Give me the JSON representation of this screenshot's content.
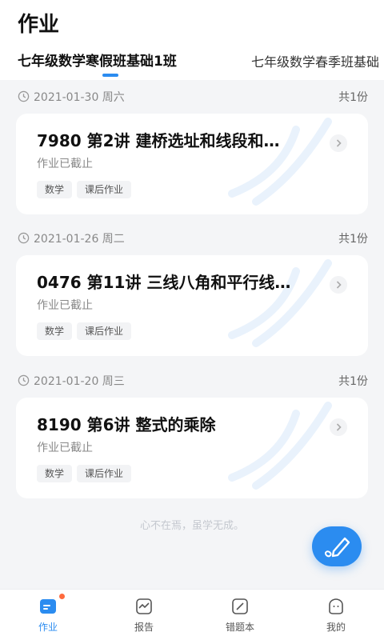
{
  "header": {
    "title": "作业"
  },
  "tabs": [
    {
      "label": "七年级数学寒假班基础1班",
      "active": true
    },
    {
      "label": "七年级数学春季班基础",
      "active": false
    }
  ],
  "groups": [
    {
      "date": "2021-01-30 周六",
      "count": "共1份",
      "card": {
        "title": "7980 第2讲 建桥选址和线段和…",
        "status": "作业已截止",
        "tags": [
          "数学",
          "课后作业"
        ]
      }
    },
    {
      "date": "2021-01-26 周二",
      "count": "共1份",
      "card": {
        "title": "0476 第11讲 三线八角和平行线…",
        "status": "作业已截止",
        "tags": [
          "数学",
          "课后作业"
        ]
      }
    },
    {
      "date": "2021-01-20 周三",
      "count": "共1份",
      "card": {
        "title": "8190 第6讲 整式的乘除",
        "status": "作业已截止",
        "tags": [
          "数学",
          "课后作业"
        ]
      }
    }
  ],
  "footer_motto": "心不在焉，虽学无成。",
  "bottom_nav": [
    {
      "label": "作业",
      "icon": "homework-icon",
      "active": true,
      "badge": true
    },
    {
      "label": "报告",
      "icon": "report-icon",
      "active": false
    },
    {
      "label": "错题本",
      "icon": "mistake-book-icon",
      "active": false
    },
    {
      "label": "我的",
      "icon": "profile-icon",
      "active": false
    }
  ],
  "colors": {
    "accent": "#2b8cf0",
    "badge": "#ff6a3d",
    "background": "#f4f5f7"
  }
}
